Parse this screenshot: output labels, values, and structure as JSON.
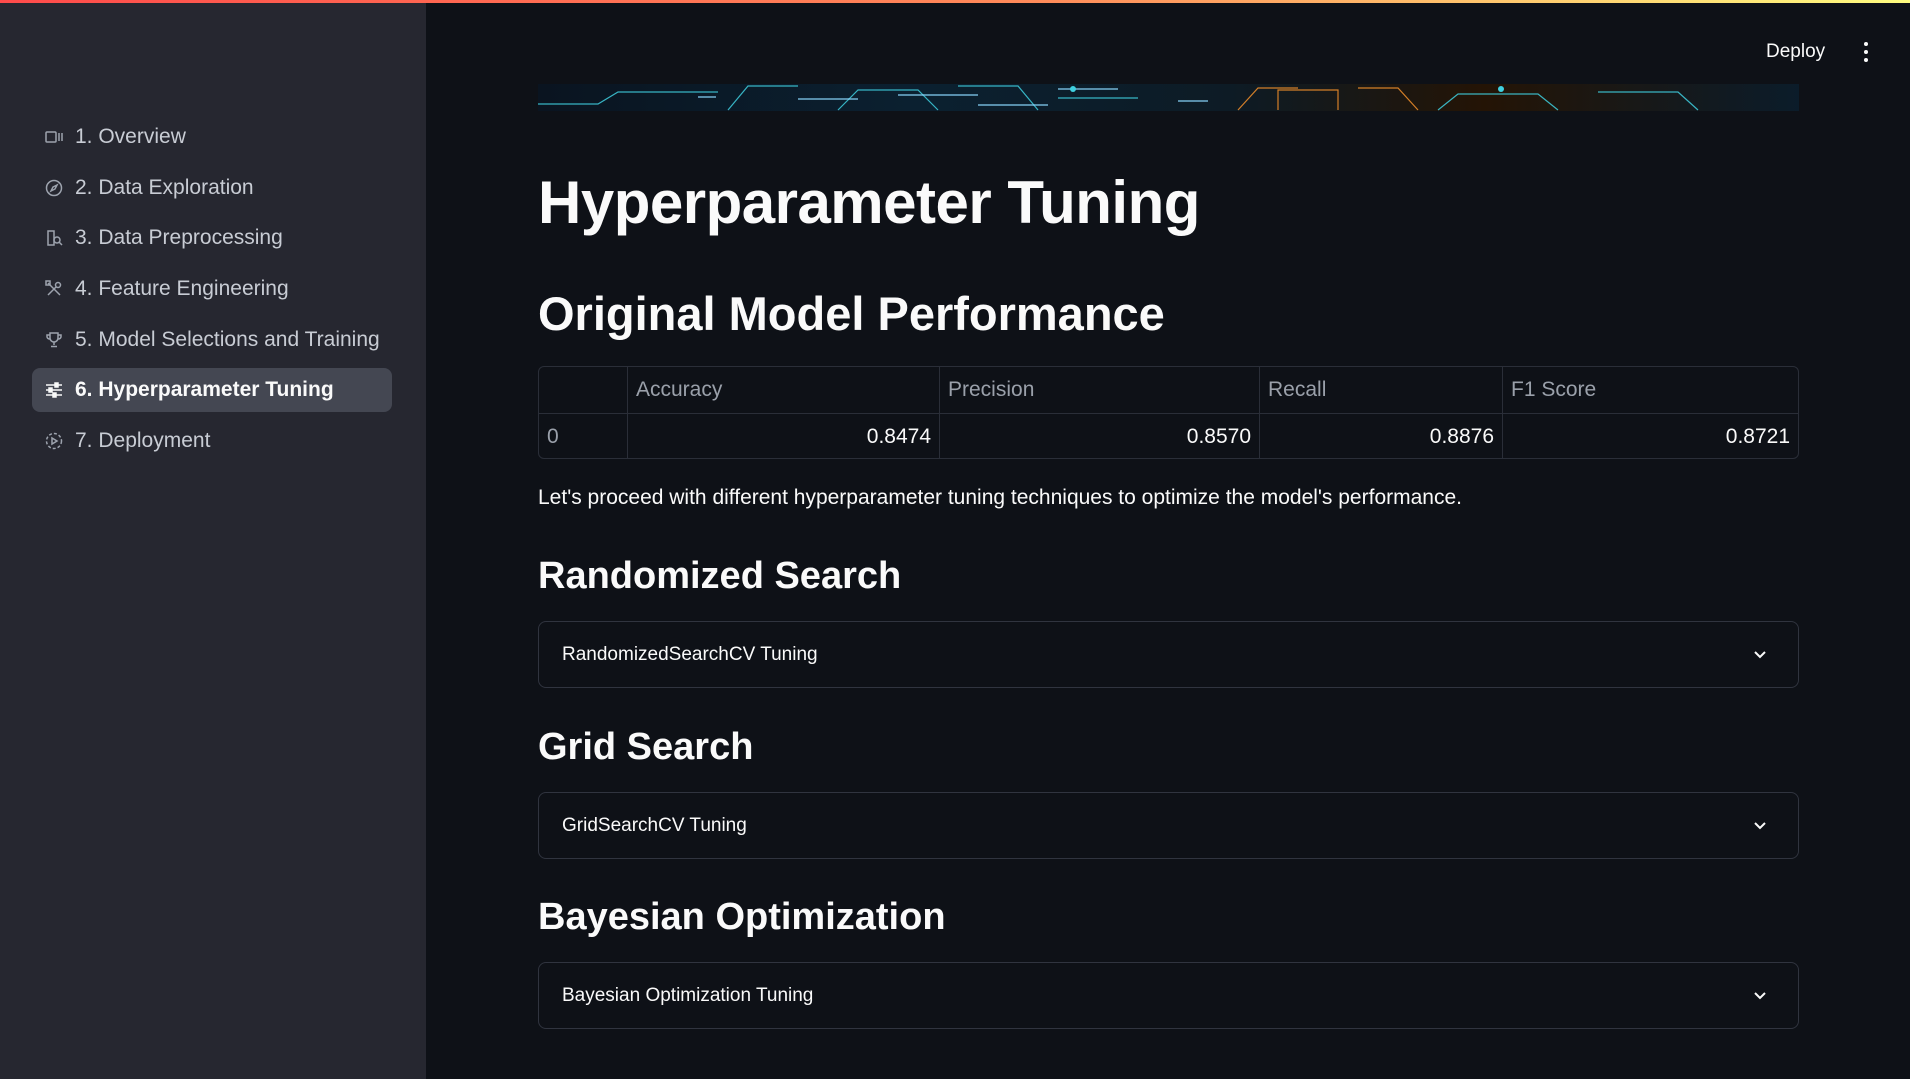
{
  "sidebar": {
    "items": [
      {
        "label": "1. Overview",
        "icon": "slideshow-icon"
      },
      {
        "label": "2. Data Exploration",
        "icon": "compass-icon"
      },
      {
        "label": "3. Data Preprocessing",
        "icon": "document-search-icon"
      },
      {
        "label": "4. Feature Engineering",
        "icon": "tools-icon"
      },
      {
        "label": "5. Model Selections and Training",
        "icon": "trophy-icon"
      },
      {
        "label": "6. Hyperparameter Tuning",
        "icon": "sliders-icon",
        "active": true
      },
      {
        "label": "7. Deployment",
        "icon": "rocket-circle-icon"
      }
    ]
  },
  "header": {
    "deploy_label": "Deploy",
    "menu_icon": "kebab-menu-icon"
  },
  "main": {
    "title": "Hyperparameter Tuning",
    "performance_heading": "Original Model Performance",
    "table": {
      "columns": [
        "",
        "Accuracy",
        "Precision",
        "Recall",
        "F1 Score"
      ],
      "rows": [
        [
          "0",
          "0.8474",
          "0.8570",
          "0.8876",
          "0.8721"
        ]
      ]
    },
    "intro": "Let's proceed with different hyperparameter tuning techniques to optimize the model's performance.",
    "sections": [
      {
        "heading": "Randomized Search",
        "expander": "RandomizedSearchCV Tuning"
      },
      {
        "heading": "Grid Search",
        "expander": "GridSearchCV Tuning"
      },
      {
        "heading": "Bayesian Optimization",
        "expander": "Bayesian Optimization Tuning"
      }
    ]
  },
  "colors": {
    "background": "#0e1117",
    "sidebar": "#262730",
    "active_item": "#444752",
    "accent": "#ff4b4b"
  }
}
